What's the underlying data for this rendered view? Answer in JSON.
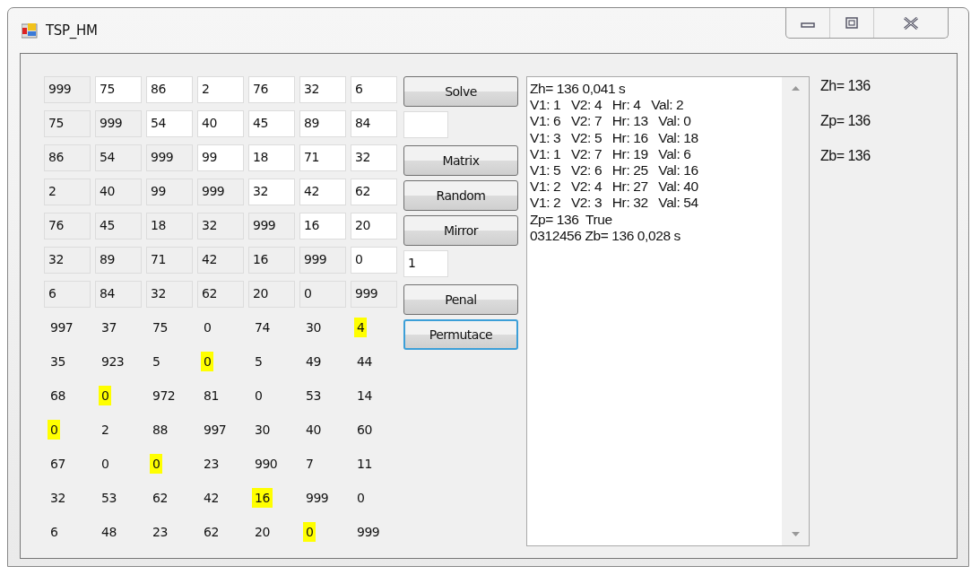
{
  "window": {
    "title": "TSP_HM"
  },
  "matrix": [
    [
      {
        "value": "999",
        "readonly": true
      },
      {
        "value": "75",
        "readonly": false
      },
      {
        "value": "86",
        "readonly": false
      },
      {
        "value": "2",
        "readonly": false
      },
      {
        "value": "76",
        "readonly": false
      },
      {
        "value": "32",
        "readonly": false
      },
      {
        "value": "6",
        "readonly": false
      }
    ],
    [
      {
        "value": "75",
        "readonly": true
      },
      {
        "value": "999",
        "readonly": true
      },
      {
        "value": "54",
        "readonly": false
      },
      {
        "value": "40",
        "readonly": false
      },
      {
        "value": "45",
        "readonly": false
      },
      {
        "value": "89",
        "readonly": false
      },
      {
        "value": "84",
        "readonly": false
      }
    ],
    [
      {
        "value": "86",
        "readonly": true
      },
      {
        "value": "54",
        "readonly": true
      },
      {
        "value": "999",
        "readonly": true
      },
      {
        "value": "99",
        "readonly": false
      },
      {
        "value": "18",
        "readonly": false
      },
      {
        "value": "71",
        "readonly": false
      },
      {
        "value": "32",
        "readonly": false
      }
    ],
    [
      {
        "value": "2",
        "readonly": true
      },
      {
        "value": "40",
        "readonly": true
      },
      {
        "value": "99",
        "readonly": true
      },
      {
        "value": "999",
        "readonly": true
      },
      {
        "value": "32",
        "readonly": false
      },
      {
        "value": "42",
        "readonly": false
      },
      {
        "value": "62",
        "readonly": false
      }
    ],
    [
      {
        "value": "76",
        "readonly": true
      },
      {
        "value": "45",
        "readonly": true
      },
      {
        "value": "18",
        "readonly": true
      },
      {
        "value": "32",
        "readonly": true
      },
      {
        "value": "999",
        "readonly": true
      },
      {
        "value": "16",
        "readonly": false
      },
      {
        "value": "20",
        "readonly": false
      }
    ],
    [
      {
        "value": "32",
        "readonly": true
      },
      {
        "value": "89",
        "readonly": true
      },
      {
        "value": "71",
        "readonly": true
      },
      {
        "value": "42",
        "readonly": true
      },
      {
        "value": "16",
        "readonly": true
      },
      {
        "value": "999",
        "readonly": true
      },
      {
        "value": "0",
        "readonly": false
      }
    ],
    [
      {
        "value": "6",
        "readonly": true
      },
      {
        "value": "84",
        "readonly": true
      },
      {
        "value": "32",
        "readonly": true
      },
      {
        "value": "62",
        "readonly": true
      },
      {
        "value": "20",
        "readonly": true
      },
      {
        "value": "0",
        "readonly": true
      },
      {
        "value": "999",
        "readonly": true
      }
    ]
  ],
  "result": [
    [
      {
        "value": "997",
        "highlighted": false
      },
      {
        "value": "37",
        "highlighted": false
      },
      {
        "value": "75",
        "highlighted": false
      },
      {
        "value": "0",
        "highlighted": false
      },
      {
        "value": "74",
        "highlighted": false
      },
      {
        "value": "30",
        "highlighted": false
      },
      {
        "value": "4",
        "highlighted": true
      }
    ],
    [
      {
        "value": "35",
        "highlighted": false
      },
      {
        "value": "923",
        "highlighted": false
      },
      {
        "value": "5",
        "highlighted": false
      },
      {
        "value": "0",
        "highlighted": true
      },
      {
        "value": "5",
        "highlighted": false
      },
      {
        "value": "49",
        "highlighted": false
      },
      {
        "value": "44",
        "highlighted": false
      }
    ],
    [
      {
        "value": "68",
        "highlighted": false
      },
      {
        "value": "0",
        "highlighted": true
      },
      {
        "value": "972",
        "highlighted": false
      },
      {
        "value": "81",
        "highlighted": false
      },
      {
        "value": "0",
        "highlighted": false
      },
      {
        "value": "53",
        "highlighted": false
      },
      {
        "value": "14",
        "highlighted": false
      }
    ],
    [
      {
        "value": "0",
        "highlighted": true
      },
      {
        "value": "2",
        "highlighted": false
      },
      {
        "value": "88",
        "highlighted": false
      },
      {
        "value": "997",
        "highlighted": false
      },
      {
        "value": "30",
        "highlighted": false
      },
      {
        "value": "40",
        "highlighted": false
      },
      {
        "value": "60",
        "highlighted": false
      }
    ],
    [
      {
        "value": "67",
        "highlighted": false
      },
      {
        "value": "0",
        "highlighted": false
      },
      {
        "value": "0",
        "highlighted": true
      },
      {
        "value": "23",
        "highlighted": false
      },
      {
        "value": "990",
        "highlighted": false
      },
      {
        "value": "7",
        "highlighted": false
      },
      {
        "value": "11",
        "highlighted": false
      }
    ],
    [
      {
        "value": "32",
        "highlighted": false
      },
      {
        "value": "53",
        "highlighted": false
      },
      {
        "value": "62",
        "highlighted": false
      },
      {
        "value": "42",
        "highlighted": false
      },
      {
        "value": "16",
        "highlighted": true
      },
      {
        "value": "999",
        "highlighted": false
      },
      {
        "value": "0",
        "highlighted": false
      }
    ],
    [
      {
        "value": "6",
        "highlighted": false
      },
      {
        "value": "48",
        "highlighted": false
      },
      {
        "value": "23",
        "highlighted": false
      },
      {
        "value": "62",
        "highlighted": false
      },
      {
        "value": "20",
        "highlighted": false
      },
      {
        "value": "0",
        "highlighted": true
      },
      {
        "value": "999",
        "highlighted": false
      }
    ]
  ],
  "controls": [
    {
      "kind": "button",
      "label": "Solve",
      "focused": false
    },
    {
      "kind": "field"
    },
    {
      "kind": "button",
      "label": "Matrix",
      "focused": false
    },
    {
      "kind": "button",
      "label": "Random",
      "focused": false
    },
    {
      "kind": "button",
      "label": "Mirror",
      "focused": false
    },
    {
      "kind": "field",
      "value": "1"
    },
    {
      "kind": "button",
      "label": "Penal",
      "focused": false
    },
    {
      "kind": "button",
      "label": "Permutace",
      "focused": true
    }
  ],
  "log": [
    "Zh= 136 0,041 s",
    "V1: 1   V2: 4   Hr: 4   Val: 2",
    "V1: 6   V2: 7   Hr: 13   Val: 0",
    "V1: 3   V2: 5   Hr: 16   Val: 18",
    "V1: 1   V2: 7   Hr: 19   Val: 6",
    "V1: 5   V2: 6   Hr: 25   Val: 16",
    "V1: 2   V2: 4   Hr: 27   Val: 40",
    "V1: 2   V2: 3   Hr: 32   Val: 54",
    "Zp= 136  True",
    "0312456 Zb= 136 0,028 s"
  ],
  "results": [
    "Zh= 136",
    "Zp= 136",
    "Zb= 136"
  ]
}
